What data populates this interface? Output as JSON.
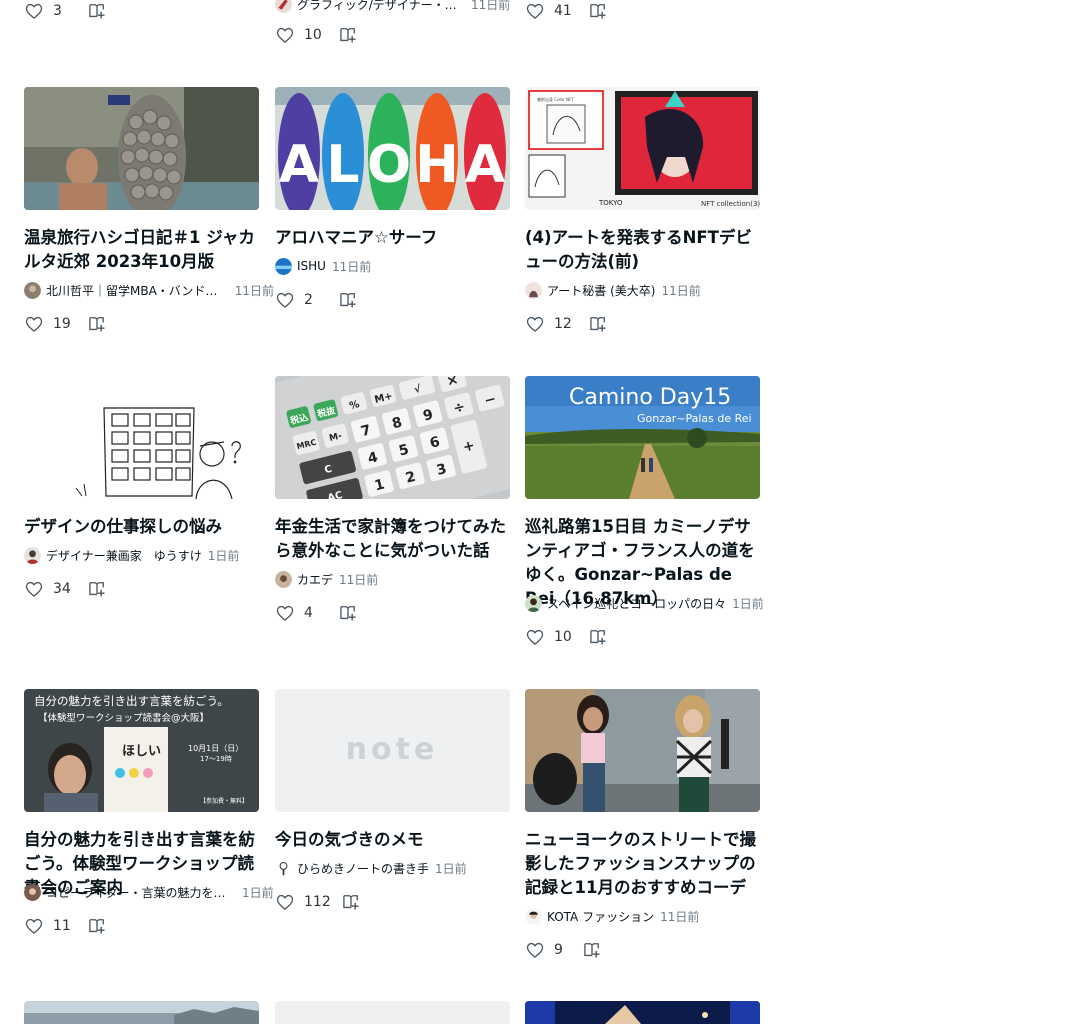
{
  "icons": {
    "like": "heart-outline-icon",
    "magazine": "add-to-magazine-icon"
  },
  "top_row": [
    {
      "likes": "3"
    },
    {
      "author": "グラフィック/デザイナー・イラストレーター",
      "time": "11日前",
      "likes": "10"
    },
    {
      "likes": "41"
    }
  ],
  "articles": [
    {
      "title": "温泉旅行ハシゴ日記＃1 ジャカルタ近郊 2023年10月版",
      "author": "北川哲平｜留学MBA・バンドン在住",
      "time": "11日前",
      "likes": "19"
    },
    {
      "title": "アロハマニア☆サーフ",
      "author": "ISHU",
      "time": "11日前",
      "likes": "2"
    },
    {
      "title": "(4)アートを発表するNFTデビューの方法(前)",
      "author": "アート秘書 (美大卒)",
      "time": "11日前",
      "likes": "12"
    },
    {
      "title": "デザインの仕事探しの悩み",
      "author": "デザイナー兼画家　ゆうすけ",
      "time": "1日前",
      "likes": "34"
    },
    {
      "title": "年金生活で家計簿をつけてみたら意外なことに気がついた話",
      "author": "カエデ",
      "time": "11日前",
      "likes": "4"
    },
    {
      "title": "巡礼路第15日目 カミーノデサンティアゴ・フランス人の道をゆく。Gonzar~Palas de Rei（16.87km）",
      "author": "スペイン巡礼とヨーロッパの日々",
      "time": "1日前",
      "likes": "10"
    },
    {
      "title": "自分の魅力を引き出す言葉を紡ごう。体験型ワークショップ読書会のご案内",
      "author": "コピーライター・言葉の魅力を引き出すワークショップ主宰",
      "time": "1日前",
      "likes": "11"
    },
    {
      "title": "今日の気づきのメモ",
      "author": "ひらめきノートの書き手",
      "time": "1日前",
      "likes": "112"
    },
    {
      "title": "ニューヨークのストリートで撮影したファッションスナップの記録と11月のおすすめコーデ",
      "author": "KOTA ファッション",
      "time": "11日前",
      "likes": "9"
    }
  ],
  "thumb_text": {
    "aloha": [
      "A",
      "L",
      "O",
      "H",
      "A"
    ],
    "camino_title": "Camino Day15",
    "camino_sub": "Gonzar~Palas de Rei",
    "note_logo": "note",
    "ws_heading": "自分の魅力を引き出す言葉を紡ごう。",
    "ws_sub": "【体験型ワークショップ読書会@大阪】",
    "ws_book": "ほしい",
    "ws_date": "10月1日（日）",
    "ws_time": "17〜19時",
    "ws_fee": "【参加費・無料】",
    "nft_label": "NFT collection(3)",
    "nft_small": "美術出身 Color NFT",
    "nft_tokyo": "TOKYO",
    "calc_keys": [
      "税込",
      "税抜",
      "%",
      "M+",
      "MRC",
      "M-",
      "7",
      "8",
      "9",
      "4",
      "5",
      "6",
      "1",
      "2",
      "3",
      "+",
      "÷",
      "×",
      "−",
      "√",
      "C",
      "AC"
    ]
  }
}
